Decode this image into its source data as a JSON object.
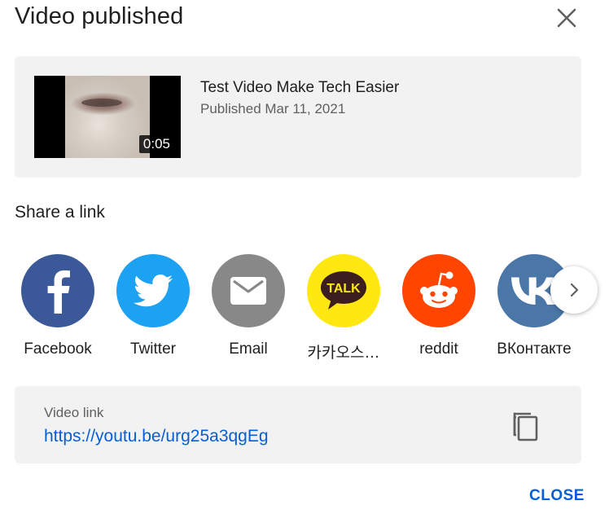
{
  "dialog": {
    "title": "Video published",
    "close_icon": "close-x-icon"
  },
  "video": {
    "title": "Test Video Make Tech Easier",
    "published": "Published Mar 11, 2021",
    "duration": "0:05"
  },
  "share": {
    "heading": "Share a link",
    "items": [
      {
        "label": "Facebook",
        "icon": "facebook-icon",
        "color": "#3b5998"
      },
      {
        "label": "Twitter",
        "icon": "twitter-icon",
        "color": "#1da1f2"
      },
      {
        "label": "Email",
        "icon": "email-icon",
        "color": "#888888"
      },
      {
        "label": "카카오스…",
        "icon": "kakaotalk-icon",
        "color": "#ffe812"
      },
      {
        "label": "reddit",
        "icon": "reddit-icon",
        "color": "#ff4500"
      },
      {
        "label": "ВКонтакте",
        "icon": "vk-icon",
        "color": "#4a76a8"
      }
    ],
    "next_icon": "chevron-right-icon"
  },
  "link": {
    "label": "Video link",
    "url": "https://youtu.be/urg25a3qgEg",
    "copy_icon": "copy-icon"
  },
  "footer": {
    "close_label": "CLOSE"
  },
  "colors": {
    "accent": "#065fd4",
    "card_bg": "#f2f2f2"
  }
}
